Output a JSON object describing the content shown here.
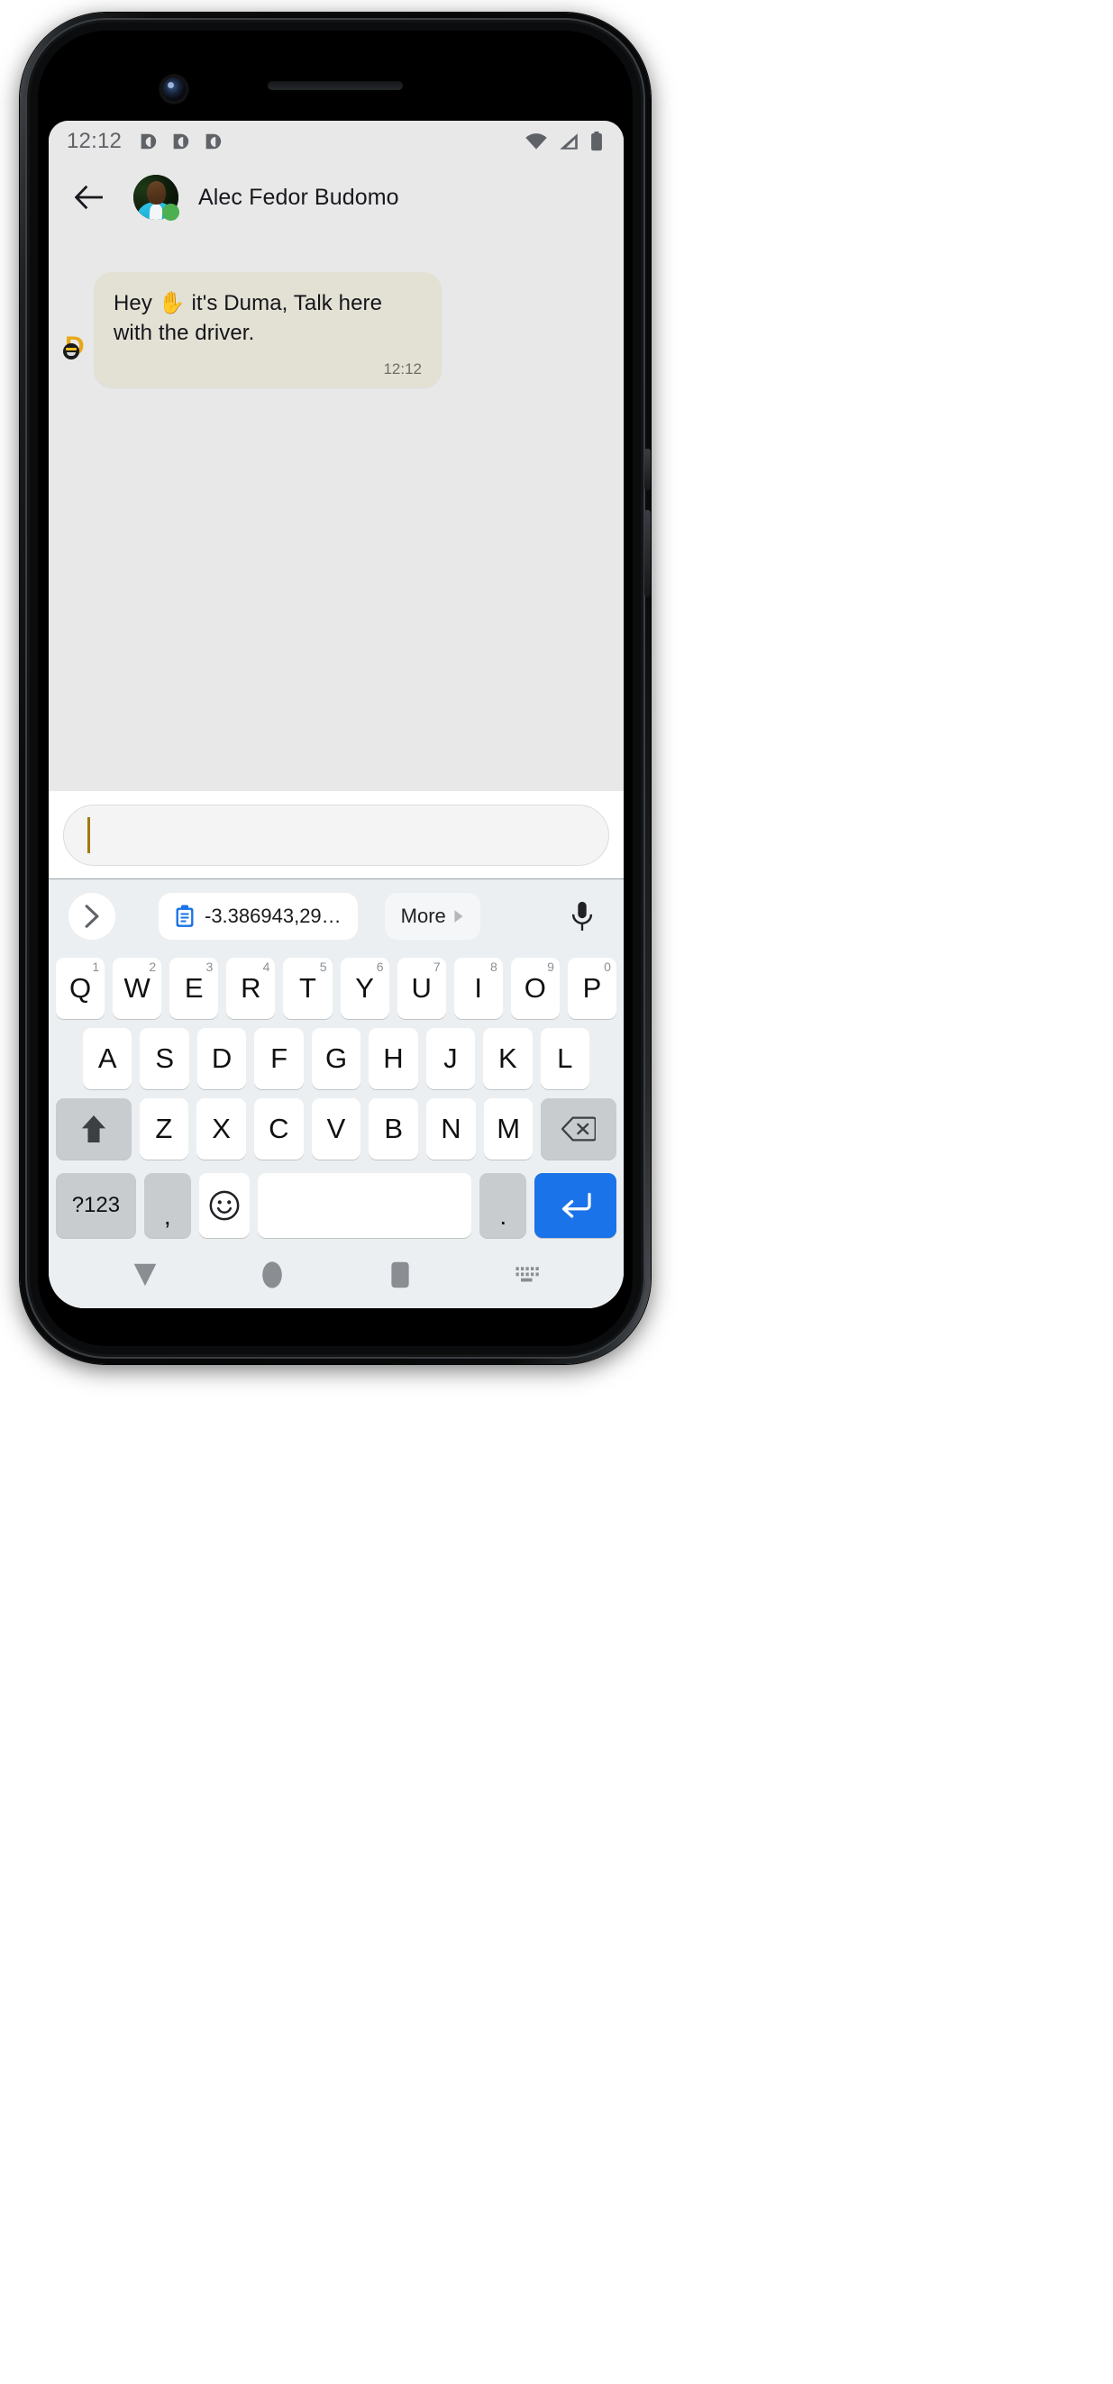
{
  "device": {
    "frame": "android-phone-mockup",
    "camera": "front-camera-lens",
    "speaker": "earpiece-speaker"
  },
  "status_bar": {
    "time": "12:12",
    "notification_icons": [
      "duma-notification-icon",
      "duma-notification-icon",
      "duma-notification-icon"
    ],
    "right_icons": [
      "wifi-icon",
      "cellular-signal-icon",
      "battery-icon"
    ]
  },
  "header": {
    "back_icon": "back-arrow-icon",
    "avatar": "contact-avatar-photo",
    "online_badge": "online-status-badge",
    "peer_name": "Alec Fedor Budomo"
  },
  "conversation": {
    "messages": [
      {
        "sender_avatar": "duma-logo-avatar",
        "sender_initial": "D",
        "text": "Hey ✋ it's Duma, Talk here with the driver.",
        "time": "12:12",
        "incoming": true
      }
    ]
  },
  "composer": {
    "value": "",
    "placeholder": "",
    "caret": "text-cursor"
  },
  "keyboard": {
    "suggestion_bar": {
      "expand_icon": "chevron-right-icon",
      "clipboard_icon": "clipboard-icon",
      "clipboard_text": "-3.386943,29…",
      "more_label": "More",
      "more_arrow": "triangle-right-icon",
      "mic_icon": "microphone-icon"
    },
    "row1": [
      {
        "key": "Q",
        "num": "1"
      },
      {
        "key": "W",
        "num": "2"
      },
      {
        "key": "E",
        "num": "3"
      },
      {
        "key": "R",
        "num": "4"
      },
      {
        "key": "T",
        "num": "5"
      },
      {
        "key": "Y",
        "num": "6"
      },
      {
        "key": "U",
        "num": "7"
      },
      {
        "key": "I",
        "num": "8"
      },
      {
        "key": "O",
        "num": "9"
      },
      {
        "key": "P",
        "num": "0"
      }
    ],
    "row2": [
      "A",
      "S",
      "D",
      "F",
      "G",
      "H",
      "J",
      "K",
      "L"
    ],
    "row3": {
      "shift_icon": "shift-up-arrow-icon",
      "letters": [
        "Z",
        "X",
        "C",
        "V",
        "B",
        "N",
        "M"
      ],
      "backspace_icon": "backspace-icon"
    },
    "row4": {
      "symbols_label": "?123",
      "comma_label": ",",
      "emoji_icon": "emoji-smiley-icon",
      "space_label": "",
      "period_label": ".",
      "enter_icon": "enter-return-icon"
    }
  },
  "navigation_bar": {
    "items": [
      "dismiss-keyboard-down-icon",
      "home-circle-icon",
      "recents-square-icon",
      "keyboard-switcher-icon"
    ]
  },
  "colors": {
    "chat_background": "#e8e8e8",
    "bubble_incoming": "#e3e1d4",
    "accent_blue": "#1a73e8",
    "duma_yellow": "#e8a816",
    "online_green": "#4caf50",
    "keyboard_background": "#eceff1",
    "caret": "#a07a10"
  }
}
